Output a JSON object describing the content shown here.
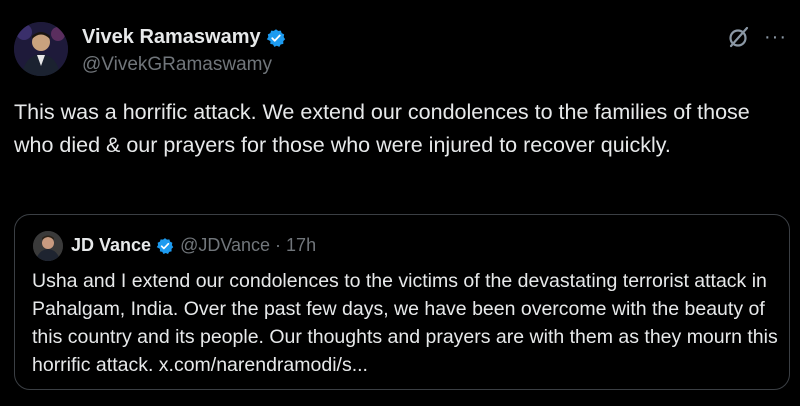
{
  "author": {
    "name": "Vivek Ramaswamy",
    "handle": "@VivekGRamaswamy",
    "verified": true,
    "verified_color": "#1d9bf0"
  },
  "tweet_text": "This was a horrific attack. We extend our condolences to the families of those who died & our prayers for those who were injured to recover quickly.",
  "header_icons": [
    "grok-icon",
    "more-options-icon"
  ],
  "more_label": "···",
  "quoted_tweet": {
    "name": "JD Vance",
    "handle": "@JDVance",
    "separator": "·",
    "time": "17h",
    "verified": true,
    "text": "Usha and I extend our condolences to the victims of the devastating terrorist attack in Pahalgam, India. Over the past few days, we have been overcome with the beauty of this country and its people. Our thoughts and prayers are with them as they mourn this horrific attack. x.com/narendramodi/s..."
  },
  "colors": {
    "background": "#000000",
    "text": "#e7e9ea",
    "secondary": "#71767b",
    "border": "#3b3f44"
  }
}
